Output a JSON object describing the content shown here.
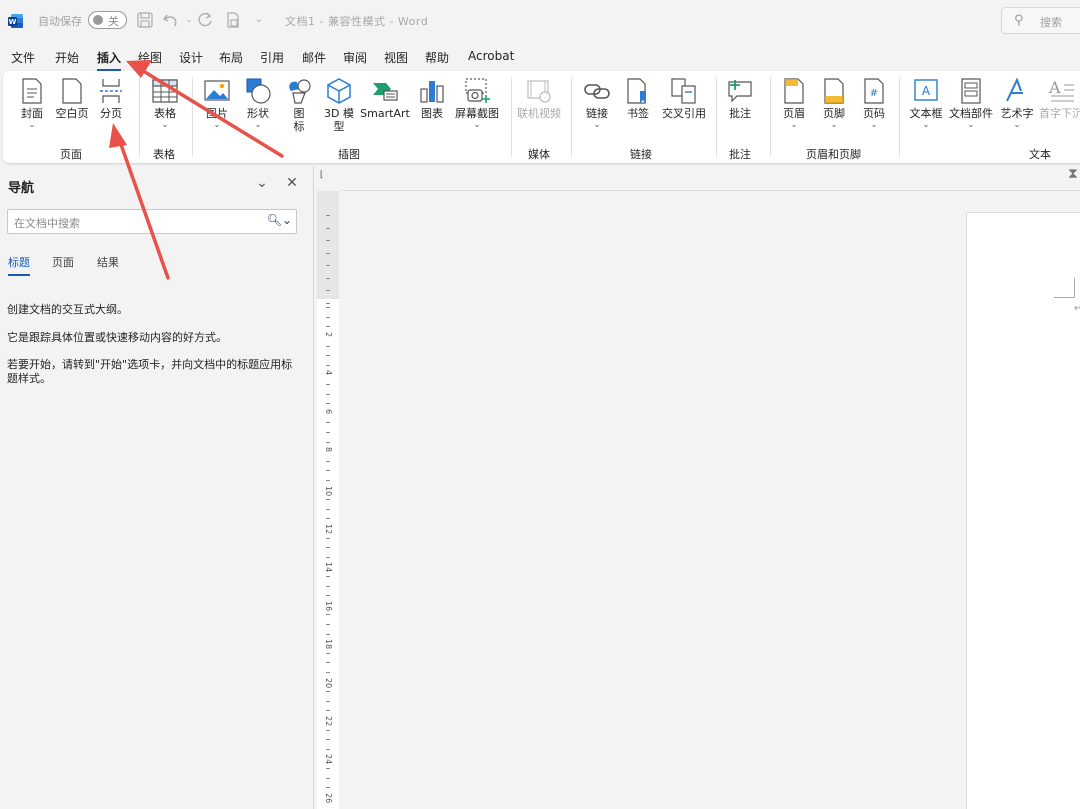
{
  "titlebar": {
    "autosave_label": "自动保存",
    "autosave_state": "关",
    "document_title": "文档1  -  兼容性模式  -  Word",
    "search_placeholder": "搜索",
    "icons": [
      "word-logo",
      "save-icon",
      "undo-icon",
      "redo-icon",
      "document-icon",
      "customize-icon"
    ]
  },
  "menu": {
    "tabs": [
      {
        "label": "文件"
      },
      {
        "label": "开始"
      },
      {
        "label": "插入"
      },
      {
        "label": "绘图"
      },
      {
        "label": "设计"
      },
      {
        "label": "布局"
      },
      {
        "label": "引用"
      },
      {
        "label": "邮件"
      },
      {
        "label": "审阅"
      },
      {
        "label": "视图"
      },
      {
        "label": "帮助"
      },
      {
        "label": "Acrobat"
      }
    ],
    "active_tab": "插入"
  },
  "ribbon": {
    "pages": {
      "cover": "封面",
      "blank": "空白页",
      "break": "分页",
      "group": "页面"
    },
    "tables": {
      "table": "表格",
      "group": "表格"
    },
    "illustrations": {
      "pictures": "图片",
      "shapes": "形状",
      "icons_line1": "图",
      "icons_line2": "标",
      "models_line1": "3D 模",
      "models_line2": "型",
      "smartart": "SmartArt",
      "chart": "图表",
      "screenshot": "屏幕截图",
      "group": "插图"
    },
    "media": {
      "online_video": "联机视频",
      "group": "媒体"
    },
    "links": {
      "link": "链接",
      "bookmark": "书签",
      "crossref": "交叉引用",
      "group": "链接"
    },
    "comments": {
      "comment": "批注",
      "group": "批注"
    },
    "header_footer": {
      "header": "页眉",
      "footer": "页脚",
      "page_number": "页码",
      "group": "页眉和页脚"
    },
    "text": {
      "textbox": "文本框",
      "quickparts": "文档部件",
      "wordart": "艺术字",
      "dropcap": "首字下沉",
      "group": "文本"
    }
  },
  "nav": {
    "title": "导航",
    "search_placeholder": "在文档中搜索",
    "tabs": [
      {
        "label": "标题"
      },
      {
        "label": "页面"
      },
      {
        "label": "结果"
      }
    ],
    "line1": "创建文档的交互式大纲。",
    "line2": "它是跟踪具体位置或快速移动内容的好方式。",
    "line3": "若要开始，请转到\"开始\"选项卡，并向文档中的标题应用标题样式。"
  },
  "ruler": {
    "marks": [
      "2",
      "4",
      "6",
      "8",
      "10",
      "12",
      "14",
      "16",
      "18",
      "20",
      "22",
      "24",
      "26"
    ]
  },
  "colors": {
    "accent": "#185abd",
    "annotation_arrow": "#e8524a"
  }
}
